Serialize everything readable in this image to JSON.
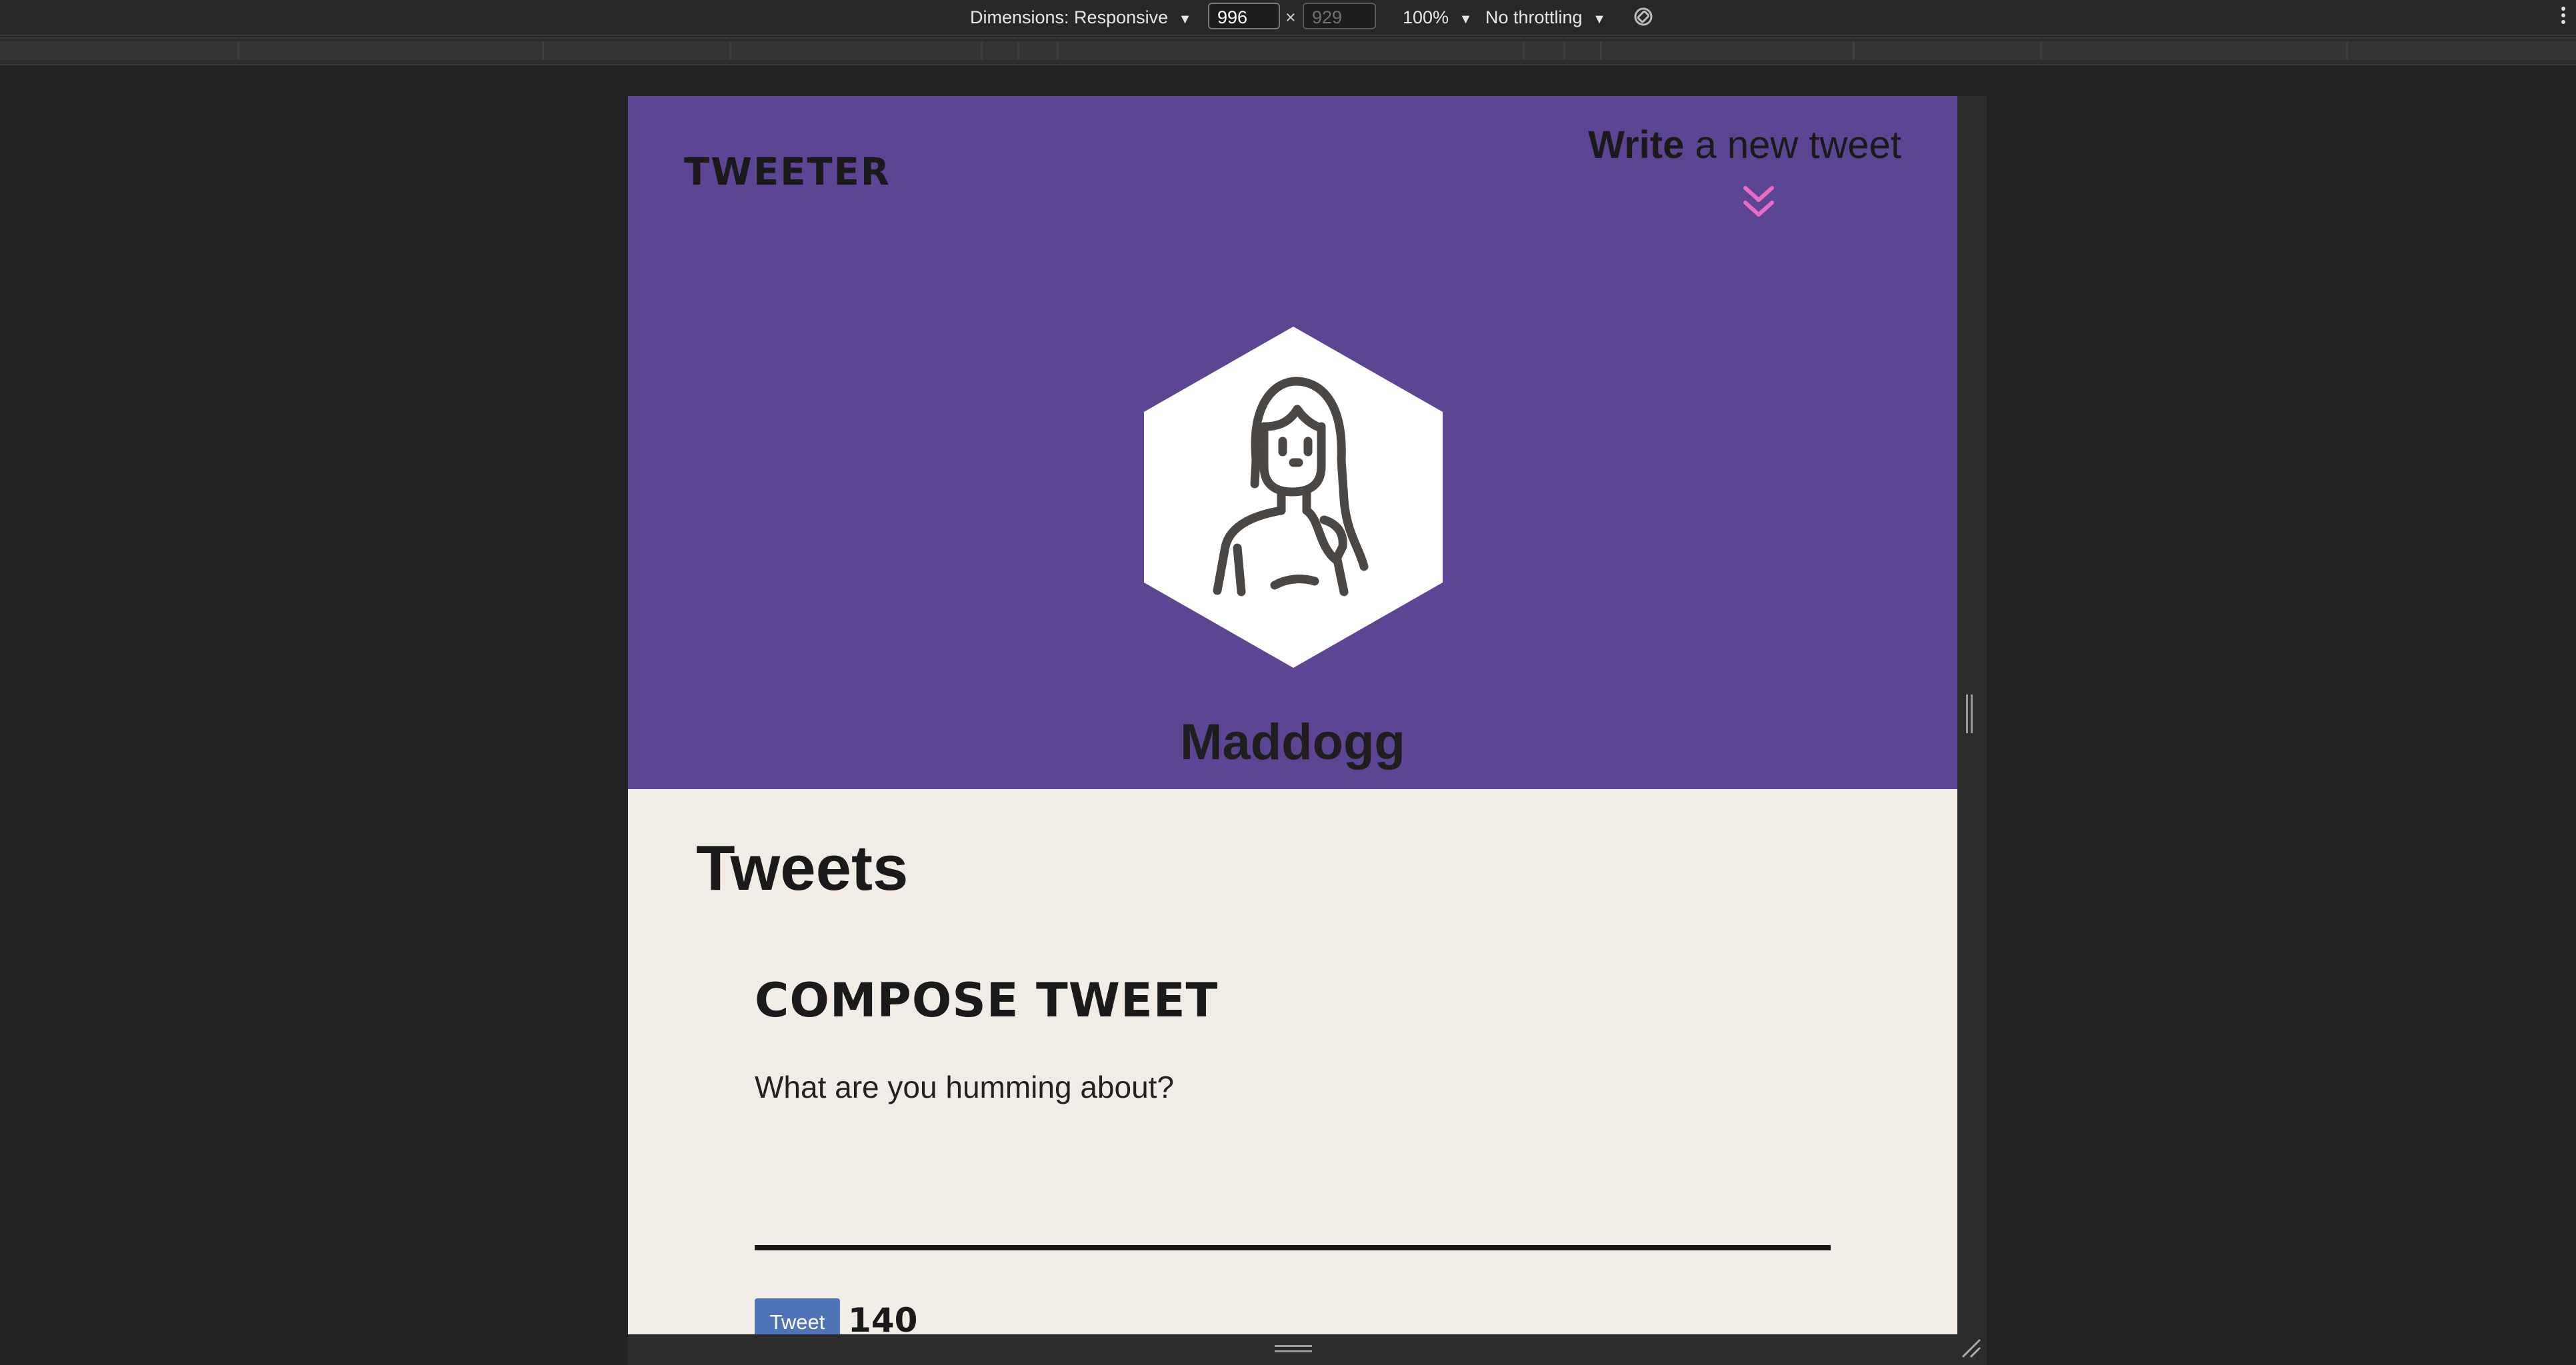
{
  "devtools": {
    "dimensions_label": "Dimensions: Responsive",
    "width_value": "996",
    "times_symbol": "×",
    "height_value": "929",
    "zoom_label": "100%",
    "throttling_label": "No throttling",
    "rotate_icon": "rotate-icon",
    "more_icon": "kebab-menu-icon"
  },
  "page": {
    "logo": "TWEETER",
    "write_link": {
      "bold": "Write",
      "rest": "a new tweet"
    },
    "chevron_icon": "double-chevron-down-icon",
    "chevron_color": "#e86cc6",
    "header_color": "#5c4593",
    "username": "Maddogg",
    "tweets_title": "Tweets",
    "compose": {
      "title": "COMPOSE TWEET",
      "placeholder": "What are you humming about?",
      "button_label": "Tweet",
      "counter": "140"
    },
    "button_color": "#4e73b6",
    "background_color": "#f1ece5"
  }
}
